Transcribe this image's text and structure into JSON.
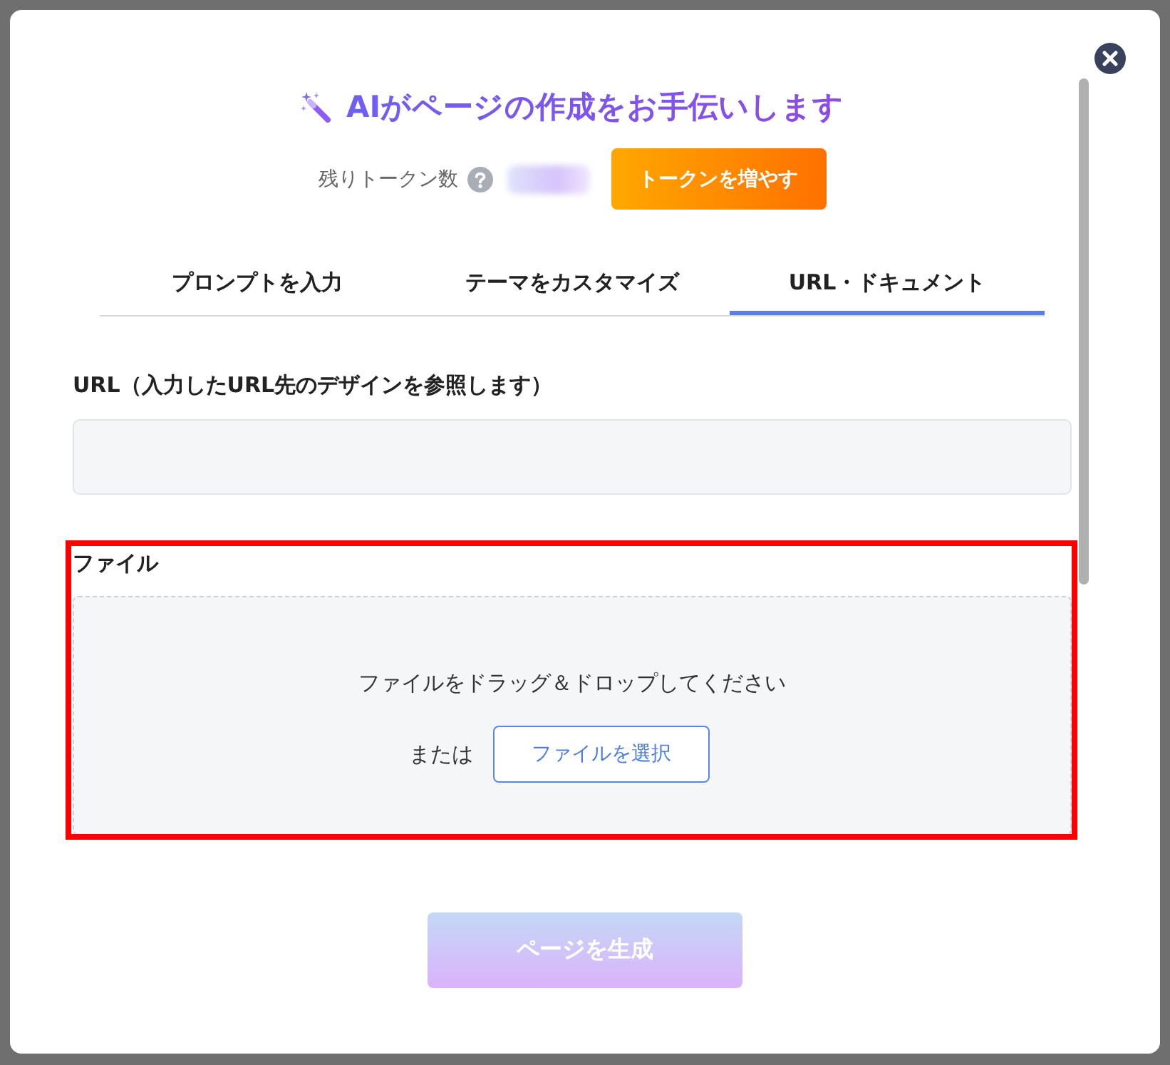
{
  "dialog": {
    "title": "AIがページの作成をお手伝いします"
  },
  "tokens": {
    "label": "残りトークン数",
    "button": "トークンを増やす"
  },
  "tabs": [
    {
      "label": "プロンプトを入力",
      "selected": false
    },
    {
      "label": "テーマをカスタマイズ",
      "selected": false
    },
    {
      "label": "URL・ドキュメント",
      "selected": true
    }
  ],
  "url_field": {
    "label": "URL（入力したURL先のデザインを参照します）"
  },
  "file_section": {
    "label": "ファイル",
    "highlighted": true,
    "drop_hint": "ファイルをドラッグ＆ドロップしてください",
    "or_text": "または",
    "button": "ファイルを選択"
  },
  "generate_button": {
    "label": "ページを生成",
    "disabled": true
  }
}
